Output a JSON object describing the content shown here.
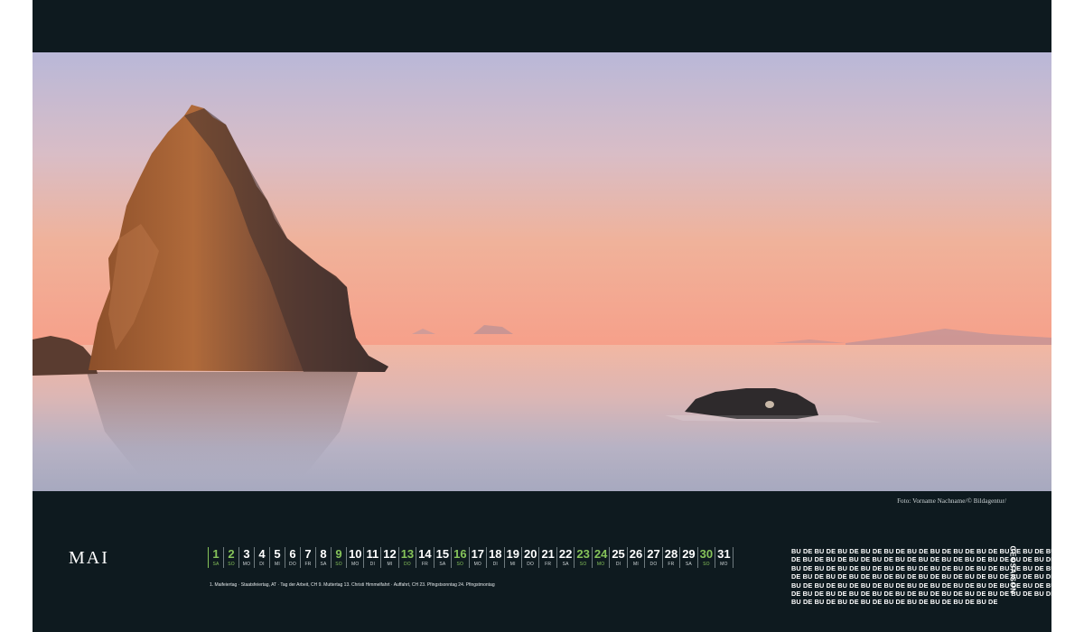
{
  "credit": "Foto: Vorname Nachname/© Bildagentur/",
  "month": "MAI",
  "colors": {
    "background": "#0e1a1f",
    "weekend_green": "#86c35a",
    "text": "#ffffff"
  },
  "days": [
    {
      "num": "1",
      "wd": "SA",
      "weekend": true
    },
    {
      "num": "2",
      "wd": "SO",
      "weekend": true
    },
    {
      "num": "3",
      "wd": "MO",
      "weekend": false
    },
    {
      "num": "4",
      "wd": "DI",
      "weekend": false
    },
    {
      "num": "5",
      "wd": "MI",
      "weekend": false
    },
    {
      "num": "6",
      "wd": "DO",
      "weekend": false
    },
    {
      "num": "7",
      "wd": "FR",
      "weekend": false
    },
    {
      "num": "8",
      "wd": "SA",
      "weekend": false
    },
    {
      "num": "9",
      "wd": "SO",
      "weekend": true
    },
    {
      "num": "10",
      "wd": "MO",
      "weekend": false
    },
    {
      "num": "11",
      "wd": "DI",
      "weekend": false
    },
    {
      "num": "12",
      "wd": "MI",
      "weekend": false
    },
    {
      "num": "13",
      "wd": "DO",
      "weekend": true
    },
    {
      "num": "14",
      "wd": "FR",
      "weekend": false
    },
    {
      "num": "15",
      "wd": "SA",
      "weekend": false
    },
    {
      "num": "16",
      "wd": "SO",
      "weekend": true
    },
    {
      "num": "17",
      "wd": "MO",
      "weekend": false
    },
    {
      "num": "18",
      "wd": "DI",
      "weekend": false
    },
    {
      "num": "19",
      "wd": "MI",
      "weekend": false
    },
    {
      "num": "20",
      "wd": "DO",
      "weekend": false
    },
    {
      "num": "21",
      "wd": "FR",
      "weekend": false
    },
    {
      "num": "22",
      "wd": "SA",
      "weekend": false
    },
    {
      "num": "23",
      "wd": "SO",
      "weekend": true
    },
    {
      "num": "24",
      "wd": "MO",
      "weekend": true
    },
    {
      "num": "25",
      "wd": "DI",
      "weekend": false
    },
    {
      "num": "26",
      "wd": "MI",
      "weekend": false
    },
    {
      "num": "27",
      "wd": "DO",
      "weekend": false
    },
    {
      "num": "28",
      "wd": "FR",
      "weekend": false
    },
    {
      "num": "29",
      "wd": "SA",
      "weekend": false
    },
    {
      "num": "30",
      "wd": "SO",
      "weekend": true
    },
    {
      "num": "31",
      "wd": "MO",
      "weekend": false
    }
  ],
  "holidays": "1. Maifeiertag · Staatsfeiertag, AT · Tag der Arbeit, CH   9. Muttertag   13. Christi Himmelfahrt · Auffahrt, CH   23. Pfingstsonntag   24. Pfingstmontag",
  "bu_lines": [
    "BU DE BU DE BU DE BU DE BU DE BU DE BU DE BU DE BU DE BU DE BU DE BU DE BU",
    "DE BU DE BU DE BU DE BU DE BU DE BU DE BU DE BU DE BU DE BU DE BU DE BU DE",
    "BU DE BU DE BU DE BU DE BU DE BU DE BU DE BU DE BU DE BU DE BU DE BU DE BU",
    "DE BU DE BU DE BU DE BU DE BU DE BU DE BU DE BU DE BU DE BU DE BU DE BU DE",
    "BU DE BU DE BU DE BU DE BU DE BU DE BU DE BU DE BU DE BU DE BU DE BU DE BU",
    "DE BU DE BU DE BU DE BU DE BU DE BU DE BU DE BU DE BU DE BU DE BU DE BU DE",
    "BU DE BU DE BU DE BU DE BU DE BU DE BU DE BU DE BU DE"
  ],
  "brand": "GEOSAISON"
}
